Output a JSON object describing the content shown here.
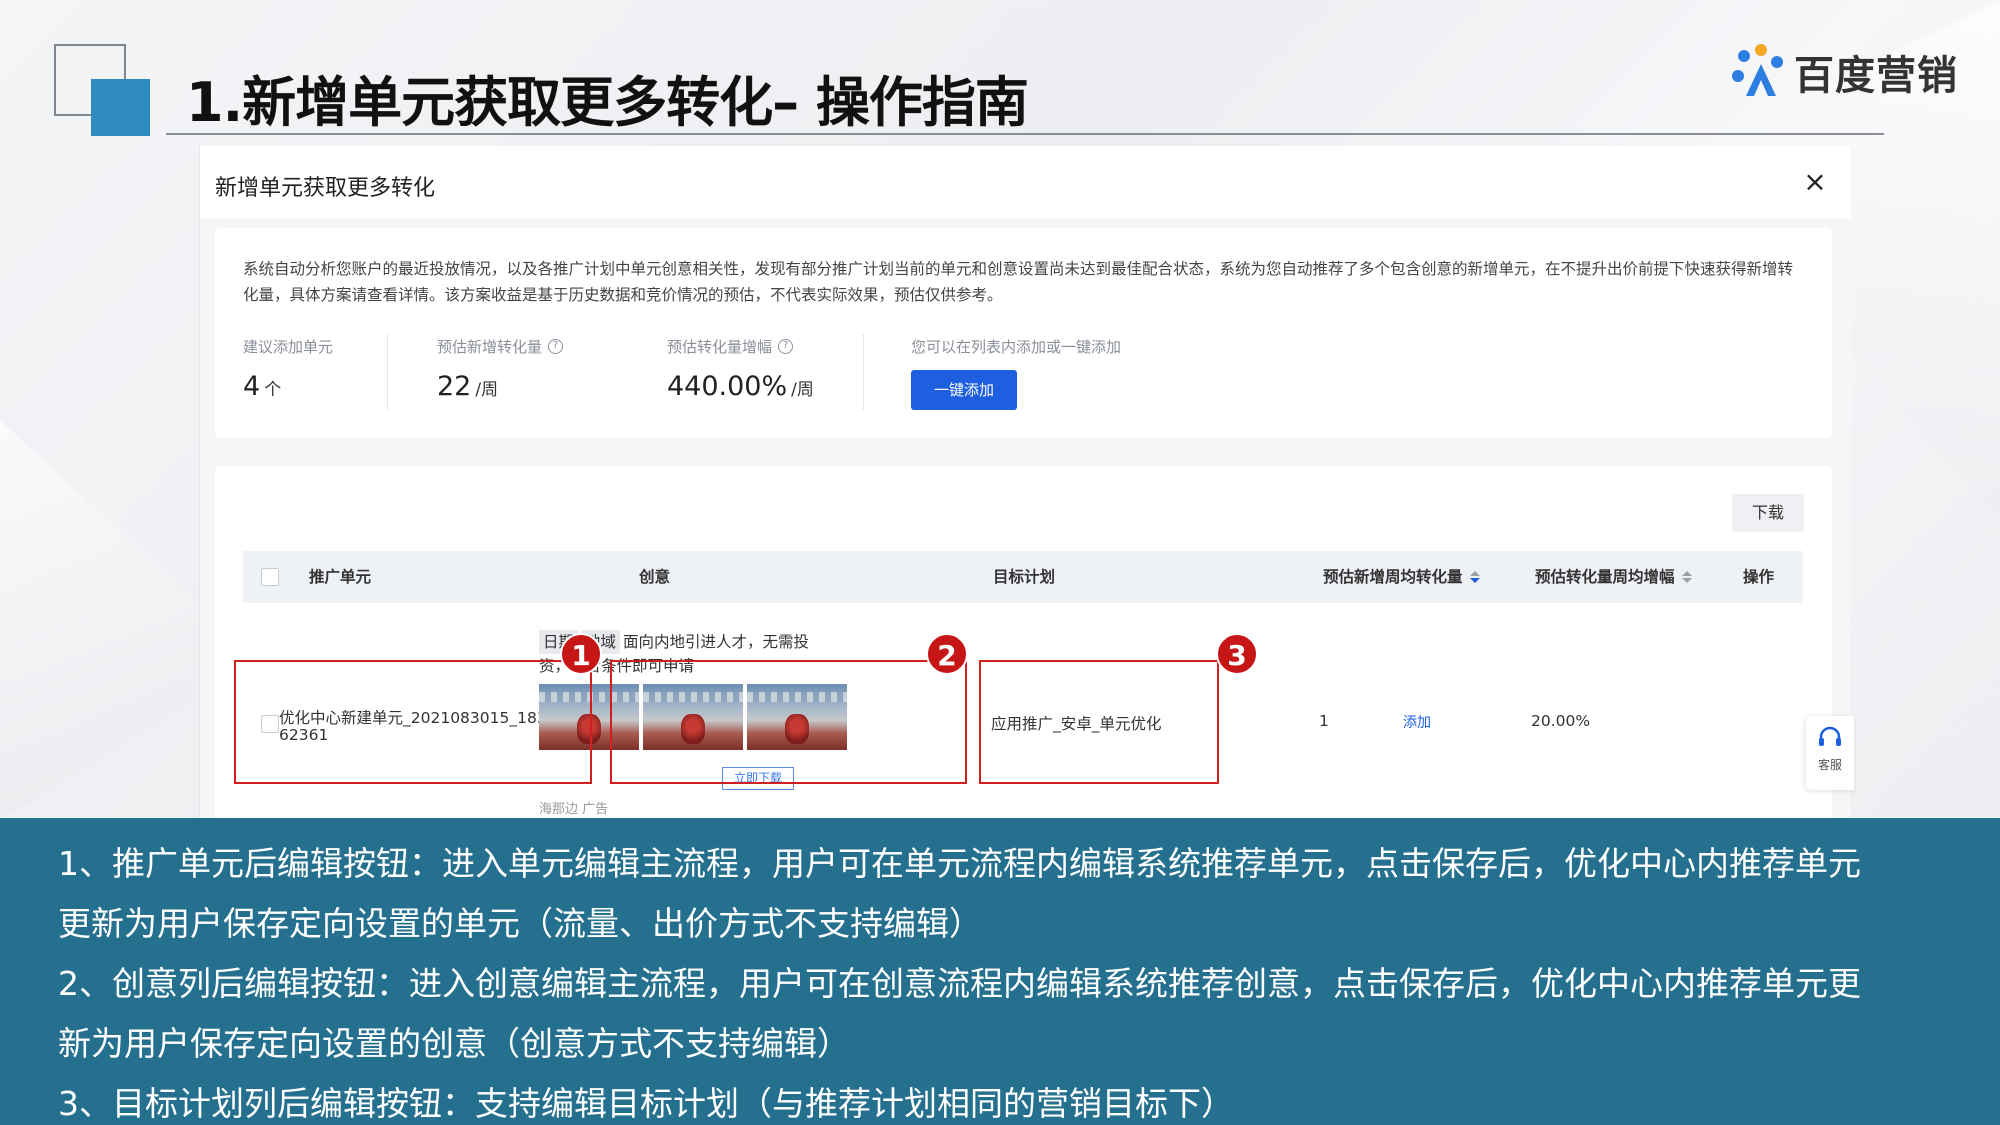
{
  "slide": {
    "title": "1.新增单元获取更多转化– 操作指南",
    "logo_text": "百度营销",
    "accent_color": "#2e8bc0"
  },
  "dialog": {
    "title": "新增单元获取更多转化",
    "close_icon": "×",
    "description": "系统自动分析您账户的最近投放情况，以及各推广计划中单元创意相关性，发现有部分推广计划当前的单元和创意设置尚未达到最佳配合状态，系统为您自动推荐了多个包含创意的新增单元，在不提升出价前提下快速获得新增转化量，具体方案请查看详情。该方案收益是基于历史数据和竞价情况的预估，不代表实际效果，预估仅供参考。",
    "stats": [
      {
        "label": "建议添加单元",
        "value": "4",
        "unit": "个"
      },
      {
        "label": "预估新增转化量",
        "value": "22",
        "unit": "/周"
      },
      {
        "label": "预估转化量增幅",
        "value": "440.00%",
        "unit": "/周"
      }
    ],
    "add_hint": "您可以在列表内添加或一键添加",
    "one_key_add": "一键添加",
    "download": "下载",
    "columns": [
      "推广单元",
      "创意",
      "目标计划",
      "预估新增周均转化量",
      "预估转化量周均增幅",
      "操作"
    ],
    "row": {
      "unit": "优化中心新建单元_2021083015_18336 62361",
      "tags": [
        "日期",
        "地域"
      ],
      "creative_text": "面向内地引进人才，无需投资，符合条件即可申请",
      "download_now": "立即下载",
      "ad_source": "海那边 广告",
      "plan": "应用推广_安卓_单元优化",
      "weekly_conv": "1",
      "weekly_growth": "20.00%",
      "action": "添加"
    },
    "service_label": "客服"
  },
  "markers": [
    "1",
    "2",
    "3"
  ],
  "banner": {
    "color": "#25708e",
    "lines": [
      "1、推广单元后编辑按钮：进入单元编辑主流程，用户可在单元流程内编辑系统推荐单元，点击保存后，优化中心内推荐单元",
      "更新为用户保存定向设置的单元（流量、出价方式不支持编辑）",
      "2、创意列后编辑按钮：进入创意编辑主流程，用户可在创意流程内编辑系统推荐创意，点击保存后，优化中心内推荐单元更",
      "新为用户保存定向设置的创意（创意方式不支持编辑）",
      "3、目标计划列后编辑按钮：支持编辑目标计划（与推荐计划相同的营销目标下）"
    ]
  }
}
